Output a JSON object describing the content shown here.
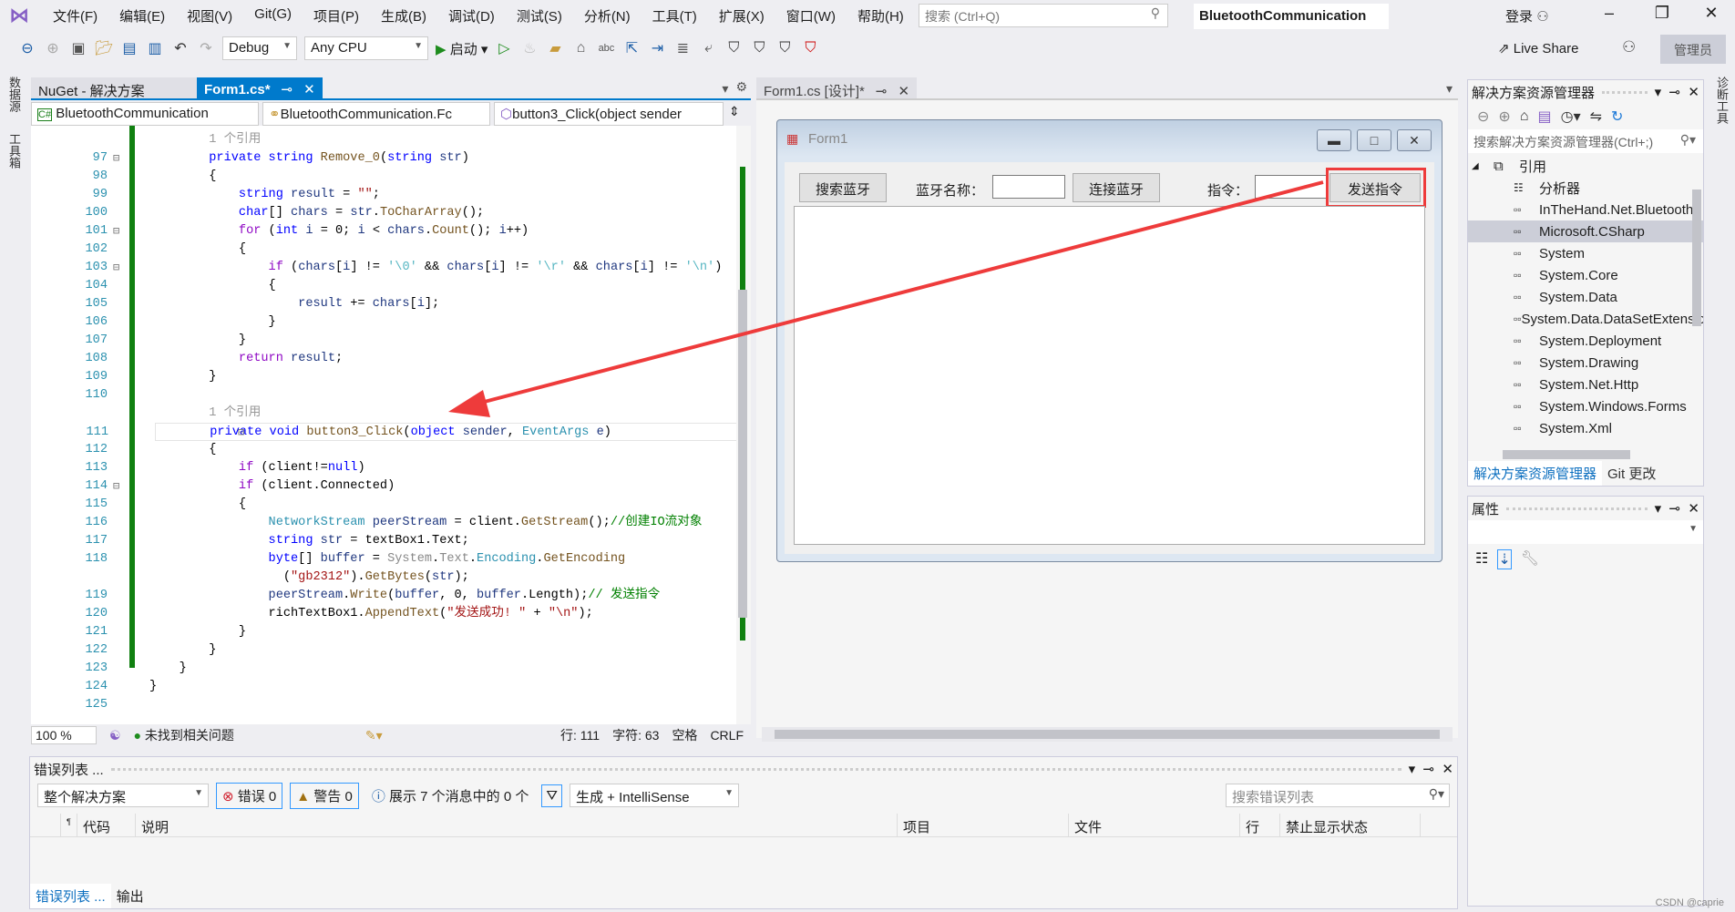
{
  "menubar": {
    "items": [
      "文件(F)",
      "编辑(E)",
      "视图(V)",
      "Git(G)",
      "项目(P)",
      "生成(B)",
      "调试(D)",
      "测试(S)",
      "分析(N)",
      "工具(T)",
      "扩展(X)",
      "窗口(W)",
      "帮助(H)"
    ],
    "search_placeholder": "搜索 (Ctrl+Q)",
    "title": "BluetoothCommunication",
    "login": "登录"
  },
  "toolbar": {
    "config": "Debug",
    "platform": "Any CPU",
    "start": "启动",
    "live_share": "Live Share",
    "admin": "管理员"
  },
  "left_strip": [
    "数据源",
    "工具箱"
  ],
  "right_strip": "诊断工具",
  "doc_tabs": [
    {
      "label": "NuGet - 解决方案"
    },
    {
      "label": "Form1.cs*",
      "active": true
    }
  ],
  "navbar": {
    "project": "BluetoothCommunication",
    "class": "BluetoothCommunication.Fc",
    "member": "button3_Click(object sender"
  },
  "code_rows": [
    {
      "ln": "",
      "t": [
        [
          "        ",
          "p"
        ],
        [
          "1 个引用",
          "g"
        ]
      ]
    },
    {
      "ln": "97",
      "t": [
        [
          "        ",
          "p"
        ],
        [
          "private",
          "kw"
        ],
        [
          " ",
          "p"
        ],
        [
          "string",
          "kw"
        ],
        [
          " ",
          "p"
        ],
        [
          "Remove_0",
          "m"
        ],
        [
          "(",
          "p"
        ],
        [
          "string",
          "kw"
        ],
        [
          " ",
          "p"
        ],
        [
          "str",
          "v"
        ],
        [
          ")",
          "p"
        ]
      ]
    },
    {
      "ln": "98",
      "t": [
        [
          "        {",
          "p"
        ]
      ]
    },
    {
      "ln": "99",
      "t": [
        [
          "            ",
          "p"
        ],
        [
          "string",
          "kw"
        ],
        [
          " ",
          "p"
        ],
        [
          "result",
          "v"
        ],
        [
          " = ",
          "p"
        ],
        [
          "\"\"",
          "str"
        ],
        [
          ";",
          "p"
        ]
      ]
    },
    {
      "ln": "100",
      "t": [
        [
          "            ",
          "p"
        ],
        [
          "char",
          "kw"
        ],
        [
          "[] ",
          "p"
        ],
        [
          "chars",
          "v"
        ],
        [
          " = ",
          "p"
        ],
        [
          "str",
          "v"
        ],
        [
          ".",
          "p"
        ],
        [
          "ToCharArray",
          "m"
        ],
        [
          "();",
          "p"
        ]
      ]
    },
    {
      "ln": "101",
      "t": [
        [
          "            ",
          "p"
        ],
        [
          "for",
          "ctl"
        ],
        [
          " (",
          "p"
        ],
        [
          "int",
          "kw"
        ],
        [
          " ",
          "p"
        ],
        [
          "i",
          "v"
        ],
        [
          " = 0; ",
          "p"
        ],
        [
          "i",
          "v"
        ],
        [
          " < ",
          "p"
        ],
        [
          "chars",
          "v"
        ],
        [
          ".",
          "p"
        ],
        [
          "Count",
          "m"
        ],
        [
          "(); ",
          "p"
        ],
        [
          "i",
          "v"
        ],
        [
          "++)",
          "p"
        ]
      ]
    },
    {
      "ln": "102",
      "t": [
        [
          "            {",
          "p"
        ]
      ]
    },
    {
      "ln": "103",
      "t": [
        [
          "                ",
          "p"
        ],
        [
          "if",
          "ctl"
        ],
        [
          " (",
          "p"
        ],
        [
          "chars",
          "v"
        ],
        [
          "[",
          "p"
        ],
        [
          "i",
          "v"
        ],
        [
          "] != ",
          "p"
        ],
        [
          "'\\0'",
          "esc"
        ],
        [
          " && ",
          "p"
        ],
        [
          "chars",
          "v"
        ],
        [
          "[",
          "p"
        ],
        [
          "i",
          "v"
        ],
        [
          "] != ",
          "p"
        ],
        [
          "'\\r'",
          "esc"
        ],
        [
          " && ",
          "p"
        ],
        [
          "chars",
          "v"
        ],
        [
          "[",
          "p"
        ],
        [
          "i",
          "v"
        ],
        [
          "] != ",
          "p"
        ],
        [
          "'\\n'",
          "esc"
        ],
        [
          ")",
          "p"
        ]
      ]
    },
    {
      "ln": "104",
      "t": [
        [
          "                {",
          "p"
        ]
      ]
    },
    {
      "ln": "105",
      "t": [
        [
          "                    ",
          "p"
        ],
        [
          "result",
          "v"
        ],
        [
          " += ",
          "p"
        ],
        [
          "chars",
          "v"
        ],
        [
          "[",
          "p"
        ],
        [
          "i",
          "v"
        ],
        [
          "];",
          "p"
        ]
      ]
    },
    {
      "ln": "106",
      "t": [
        [
          "                }",
          "p"
        ]
      ]
    },
    {
      "ln": "107",
      "t": [
        [
          "            }",
          "p"
        ]
      ]
    },
    {
      "ln": "108",
      "t": [
        [
          "            ",
          "p"
        ],
        [
          "return",
          "ctl"
        ],
        [
          " ",
          "p"
        ],
        [
          "result",
          "v"
        ],
        [
          ";",
          "p"
        ]
      ]
    },
    {
      "ln": "109",
      "t": [
        [
          "        }",
          "p"
        ]
      ]
    },
    {
      "ln": "110",
      "t": []
    },
    {
      "ln": "",
      "t": [
        [
          "        ",
          "p"
        ],
        [
          "1 个引用",
          "g"
        ]
      ]
    },
    {
      "ln": "111",
      "cur": true,
      "t": [
        [
          "        ",
          "p"
        ],
        [
          "private",
          "kw"
        ],
        [
          " ",
          "p"
        ],
        [
          "void",
          "kw"
        ],
        [
          " ",
          "p"
        ],
        [
          "button3_Click",
          "m"
        ],
        [
          "(",
          "p"
        ],
        [
          "object",
          "kw"
        ],
        [
          " ",
          "p"
        ],
        [
          "sender",
          "v"
        ],
        [
          ", ",
          "p"
        ],
        [
          "EventArgs",
          "type"
        ],
        [
          " ",
          "p"
        ],
        [
          "e",
          "v"
        ],
        [
          ")",
          "p"
        ]
      ]
    },
    {
      "ln": "112",
      "t": [
        [
          "        {",
          "p"
        ]
      ]
    },
    {
      "ln": "113",
      "t": [
        [
          "            ",
          "p"
        ],
        [
          "if",
          "ctl"
        ],
        [
          " (client!=",
          "p"
        ],
        [
          "null",
          "kw"
        ],
        [
          ")",
          "p"
        ]
      ]
    },
    {
      "ln": "114",
      "t": [
        [
          "            ",
          "p"
        ],
        [
          "if",
          "ctl"
        ],
        [
          " (client.Connected)",
          "p"
        ]
      ]
    },
    {
      "ln": "115",
      "t": [
        [
          "            {",
          "p"
        ]
      ]
    },
    {
      "ln": "116",
      "t": [
        [
          "                ",
          "p"
        ],
        [
          "NetworkStream",
          "type"
        ],
        [
          " ",
          "p"
        ],
        [
          "peerStream",
          "v"
        ],
        [
          " = client.",
          "p"
        ],
        [
          "GetStream",
          "m"
        ],
        [
          "();",
          "p"
        ],
        [
          "//创建IO流对象",
          "cm"
        ]
      ]
    },
    {
      "ln": "117",
      "t": [
        [
          "                ",
          "p"
        ],
        [
          "string",
          "kw"
        ],
        [
          " ",
          "p"
        ],
        [
          "str",
          "v"
        ],
        [
          " = textBox1.Text;",
          "p"
        ]
      ]
    },
    {
      "ln": "118",
      "t": [
        [
          "                ",
          "p"
        ],
        [
          "byte",
          "kw"
        ],
        [
          "[] ",
          "p"
        ],
        [
          "buffer",
          "v"
        ],
        [
          " = ",
          "p"
        ],
        [
          "System",
          "ns"
        ],
        [
          ".",
          "p"
        ],
        [
          "Text",
          "ns"
        ],
        [
          ".",
          "p"
        ],
        [
          "Encoding",
          "type"
        ],
        [
          ".",
          "p"
        ],
        [
          "GetEncoding",
          "m"
        ]
      ]
    },
    {
      "ln": "",
      "t": [
        [
          "                  (",
          "p"
        ],
        [
          "\"gb2312\"",
          "str"
        ],
        [
          ").",
          "p"
        ],
        [
          "GetBytes",
          "m"
        ],
        [
          "(",
          "p"
        ],
        [
          "str",
          "v"
        ],
        [
          ");",
          "p"
        ]
      ]
    },
    {
      "ln": "119",
      "t": [
        [
          "                ",
          "p"
        ],
        [
          "peerStream",
          "v"
        ],
        [
          ".",
          "p"
        ],
        [
          "Write",
          "m"
        ],
        [
          "(",
          "p"
        ],
        [
          "buffer",
          "v"
        ],
        [
          ", 0, ",
          "p"
        ],
        [
          "buffer",
          "v"
        ],
        [
          ".Length);",
          "p"
        ],
        [
          "// 发送指令",
          "cm"
        ]
      ]
    },
    {
      "ln": "120",
      "t": [
        [
          "                richTextBox1.",
          "p"
        ],
        [
          "AppendText",
          "m"
        ],
        [
          "(",
          "p"
        ],
        [
          "\"发送成功! \"",
          "str"
        ],
        [
          " + ",
          "p"
        ],
        [
          "\"\\n\"",
          "str"
        ],
        [
          ");",
          "p"
        ]
      ]
    },
    {
      "ln": "121",
      "t": [
        [
          "            }",
          "p"
        ]
      ]
    },
    {
      "ln": "122",
      "t": [
        [
          "        }",
          "p"
        ]
      ]
    },
    {
      "ln": "123",
      "t": [
        [
          "    }",
          "p"
        ]
      ]
    },
    {
      "ln": "124",
      "t": [
        [
          "}",
          "p"
        ]
      ]
    },
    {
      "ln": "125",
      "t": []
    }
  ],
  "token_colors": {
    "kw": "#0000ff",
    "ctl": "#8f08c4",
    "type": "#2b91af",
    "m": "#74531f",
    "str": "#a31515",
    "cm": "#008000",
    "v": "#1f377f"
  },
  "editor_status": {
    "zoom": "100 %",
    "issues": "未找到相关问题",
    "line": "行: 111",
    "char": "字符: 63",
    "spaces": "空格",
    "eol": "CRLF"
  },
  "designer": {
    "tab": "Form1.cs [设计]*",
    "form_title": "Form1",
    "search_btn": "搜索蓝牙",
    "name_label": "蓝牙名称：",
    "connect_btn": "连接蓝牙",
    "cmd_label": "指令：",
    "send_btn": "发送指令"
  },
  "annotation": {
    "color": "#ee3b3b",
    "highlight": "send-button -> button3_Click"
  },
  "solution_explorer": {
    "title": "解决方案资源管理器",
    "search_placeholder": "搜索解决方案资源管理器(Ctrl+;)",
    "root": "引用",
    "items": [
      "分析器",
      "InTheHand.Net.Bluetooth",
      "Microsoft.CSharp",
      "System",
      "System.Core",
      "System.Data",
      "System.Data.DataSetExtensions",
      "System.Deployment",
      "System.Drawing",
      "System.Net.Http",
      "System.Windows.Forms",
      "System.Xml"
    ],
    "selected": "Microsoft.CSharp",
    "tabs": [
      "解决方案资源管理器",
      "Git 更改"
    ]
  },
  "properties": {
    "title": "属性"
  },
  "error_list": {
    "title": "错误列表 ...",
    "scope": "整个解决方案",
    "errors": "错误 0",
    "warnings": "警告 0",
    "messages": "展示 7 个消息中的 0 个",
    "source": "生成 + IntelliSense",
    "search_placeholder": "搜索错误列表",
    "columns": [
      "代码",
      "说明",
      "项目",
      "文件",
      "行",
      "禁止显示状态"
    ],
    "tabs": [
      "错误列表 ...",
      "输出"
    ]
  },
  "watermark": "CSDN @caprie"
}
